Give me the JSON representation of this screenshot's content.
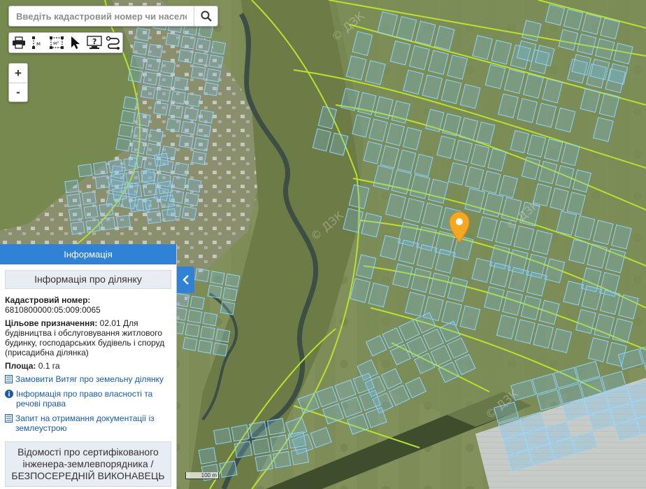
{
  "search": {
    "placeholder": "Введіть кадастровий номер чи населений пункт"
  },
  "toolbar": {
    "tools": [
      {
        "name": "print-icon"
      },
      {
        "name": "measure-distance-icon",
        "glyph": "м"
      },
      {
        "name": "measure-area-icon",
        "glyph": "м²"
      },
      {
        "name": "pointer-icon"
      },
      {
        "name": "help-icon"
      },
      {
        "name": "route-icon"
      }
    ]
  },
  "zoom": {
    "in_label": "+",
    "out_label": "-"
  },
  "marker": {
    "color": "#f5a623",
    "icon": "map-pin-icon"
  },
  "panel": {
    "header": "Інформація",
    "section_title": "Інформація про ділянку",
    "cadastral_label": "Кадастровий номер:",
    "cadastral_value": "6810800000:05:009:0065",
    "purpose_label": "Цільове призначення:",
    "purpose_value": " 02.01 Для будівництва і обслуговування житлового будинку, господарських будівель і споруд (присадибна ділянка)",
    "area_label": "Площа:",
    "area_value": " 0.1 га",
    "links": [
      {
        "icon": "document-icon",
        "text": "Замовити Витяг про земельну ділянку"
      },
      {
        "icon": "info-icon",
        "text": "Інформація про право власності та речові права"
      },
      {
        "icon": "document-icon",
        "text": "Запит на отримання документації із землеустрою"
      }
    ],
    "engineer_box": "Відомості про сертифікованого інженера-землевпорядника / БЕЗПОСЕРЕДНІЙ ВИКОНАВЕЦЬ",
    "accent": "#2f82d6"
  },
  "scale": {
    "label": "100 m"
  },
  "watermark": "© ДЗК"
}
